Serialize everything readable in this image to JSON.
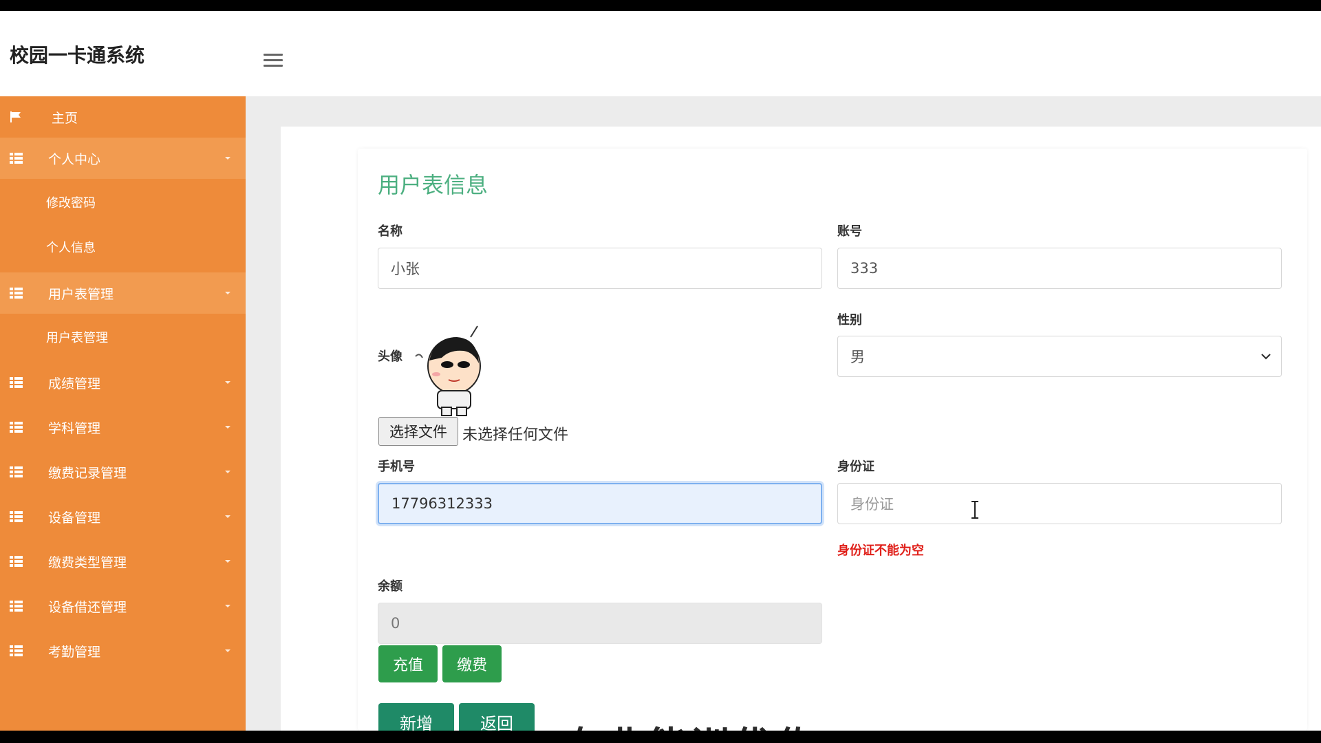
{
  "app": {
    "title": "校园一卡通系统"
  },
  "sidebar": {
    "items": [
      {
        "label": "主页",
        "icon": "flag-icon",
        "type": "top"
      },
      {
        "label": "个人中心",
        "icon": "grid-icon",
        "type": "group",
        "expanded": true
      },
      {
        "label": "修改密码",
        "type": "sub"
      },
      {
        "label": "个人信息",
        "type": "sub"
      },
      {
        "label": "用户表管理",
        "icon": "grid-icon",
        "type": "group",
        "expanded": true
      },
      {
        "label": "用户表管理",
        "type": "sub"
      },
      {
        "label": "成绩管理",
        "icon": "grid-icon",
        "type": "group"
      },
      {
        "label": "学科管理",
        "icon": "grid-icon",
        "type": "group"
      },
      {
        "label": "缴费记录管理",
        "icon": "grid-icon",
        "type": "group"
      },
      {
        "label": "设备管理",
        "icon": "grid-icon",
        "type": "group"
      },
      {
        "label": "缴费类型管理",
        "icon": "grid-icon",
        "type": "group"
      },
      {
        "label": "设备借还管理",
        "icon": "grid-icon",
        "type": "group"
      },
      {
        "label": "考勤管理",
        "icon": "grid-icon",
        "type": "group"
      }
    ]
  },
  "form": {
    "title": "用户表信息",
    "name": {
      "label": "名称",
      "value": "小张"
    },
    "account": {
      "label": "账号",
      "value": "333"
    },
    "avatar": {
      "label": "头像",
      "file_button": "选择文件",
      "file_status": "未选择任何文件"
    },
    "gender": {
      "label": "性别",
      "selected": "男"
    },
    "phone": {
      "label": "手机号",
      "value": "17796312333"
    },
    "id_card": {
      "label": "身份证",
      "placeholder": "身份证",
      "error": "身份证不能为空"
    },
    "balance": {
      "label": "余额",
      "value": "0"
    },
    "recharge_button": "充值",
    "pay_button": "缴费",
    "add_button": "新增",
    "back_button": "返回"
  },
  "overlay": {
    "text": "专业能训优佐"
  },
  "colors": {
    "sidebar": "#ee8b3a",
    "title_green": "#4caf80",
    "button_green": "#2e9d4c",
    "error_red": "#e0201a",
    "focus_blue": "#7db0ef"
  }
}
